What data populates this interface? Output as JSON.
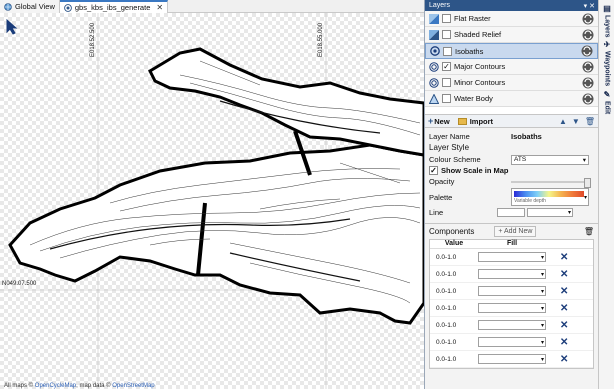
{
  "tabs": [
    {
      "label": "Global View",
      "active": false
    },
    {
      "label": "gbs_kbs_ibs_generate",
      "active": true
    }
  ],
  "map": {
    "grid_labels": {
      "v1": "E018.52.500",
      "v2": "E018.55.000",
      "h1": "N049.07.500"
    },
    "attribution": {
      "prefix": "All maps ©",
      "link1": "OpenCycleMap",
      "mid": ", map data ©",
      "link2": "OpenStreetMap"
    }
  },
  "panel": {
    "title": "Layers",
    "layers": [
      {
        "name": "Flat Raster",
        "icon": "raster-icon",
        "checked": false,
        "selected": false
      },
      {
        "name": "Shaded Relief",
        "icon": "relief-icon",
        "checked": false,
        "selected": false
      },
      {
        "name": "Isobaths",
        "icon": "isobath-icon",
        "checked": false,
        "selected": true
      },
      {
        "name": "Major Contours",
        "icon": "contour-icon",
        "checked": true,
        "selected": false
      },
      {
        "name": "Minor Contours",
        "icon": "contour-icon",
        "checked": false,
        "selected": false
      },
      {
        "name": "Water Body",
        "icon": "water-icon",
        "checked": false,
        "selected": false
      }
    ],
    "toolbar": {
      "new_label": "New",
      "import_label": "Import"
    },
    "properties": {
      "layer_name_label": "Layer Name",
      "layer_name_value": "Isobaths",
      "layer_style_label": "Layer Style",
      "colour_scheme_label": "Colour Scheme",
      "colour_scheme_value": "ATS",
      "show_scale_label": "Show Scale in Map",
      "opacity_label": "Opacity",
      "palette_label": "Palette",
      "palette_caption": "Variable depth",
      "line_label": "Line"
    },
    "components": {
      "title": "Components",
      "add_label": "Add New",
      "col_value": "Value",
      "col_fill": "Fill",
      "rows": [
        "0.0-1.0",
        "0.0-1.0",
        "0.0-1.0",
        "0.0-1.0",
        "0.0-1.0",
        "0.0-1.0",
        "0.0-1.0"
      ]
    }
  },
  "side_tabs": [
    {
      "label": "Layers",
      "icon": "layers-icon"
    },
    {
      "label": "Waypoints",
      "icon": "waypoint-icon"
    },
    {
      "label": "Edit",
      "icon": "edit-icon"
    }
  ],
  "colors": {
    "panel_title_bg": "#2d5588",
    "selected_row": "#c9d9ee",
    "link": "#2b5fb5"
  }
}
